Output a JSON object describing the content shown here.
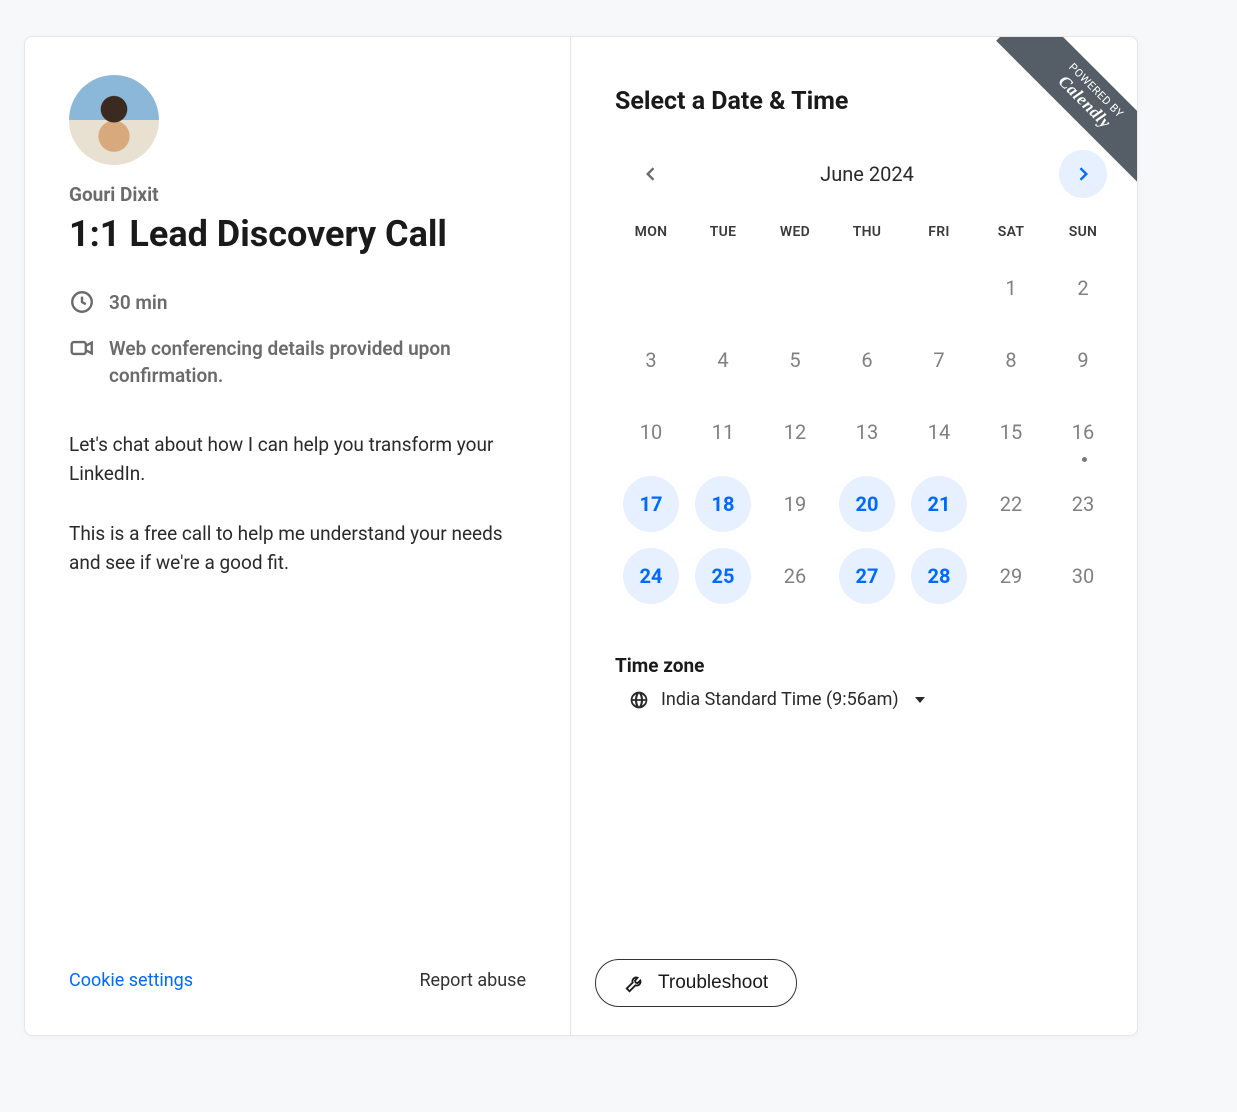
{
  "host": {
    "name": "Gouri Dixit"
  },
  "event": {
    "title": "1:1 Lead Discovery Call",
    "duration": "30 min",
    "location_note": "Web conferencing details provided upon confirmation.",
    "description_p1": "Let's chat about how I can help you transform your LinkedIn.",
    "description_p2": "This is a free call to help me understand your needs and see if we're a good fit."
  },
  "calendar": {
    "heading": "Select a Date & Time",
    "month_label": "June 2024",
    "day_headers": [
      "MON",
      "TUE",
      "WED",
      "THU",
      "FRI",
      "SAT",
      "SUN"
    ],
    "weeks": [
      [
        {
          "n": ""
        },
        {
          "n": ""
        },
        {
          "n": ""
        },
        {
          "n": ""
        },
        {
          "n": ""
        },
        {
          "n": "1",
          "state": "disabled"
        },
        {
          "n": "2",
          "state": "disabled"
        }
      ],
      [
        {
          "n": "3",
          "state": "disabled"
        },
        {
          "n": "4",
          "state": "disabled"
        },
        {
          "n": "5",
          "state": "disabled"
        },
        {
          "n": "6",
          "state": "disabled"
        },
        {
          "n": "7",
          "state": "disabled"
        },
        {
          "n": "8",
          "state": "disabled"
        },
        {
          "n": "9",
          "state": "disabled"
        }
      ],
      [
        {
          "n": "10",
          "state": "disabled"
        },
        {
          "n": "11",
          "state": "disabled"
        },
        {
          "n": "12",
          "state": "disabled"
        },
        {
          "n": "13",
          "state": "disabled"
        },
        {
          "n": "14",
          "state": "disabled"
        },
        {
          "n": "15",
          "state": "disabled"
        },
        {
          "n": "16",
          "state": "disabled",
          "today": true
        }
      ],
      [
        {
          "n": "17",
          "state": "available"
        },
        {
          "n": "18",
          "state": "available"
        },
        {
          "n": "19",
          "state": "disabled"
        },
        {
          "n": "20",
          "state": "available"
        },
        {
          "n": "21",
          "state": "available"
        },
        {
          "n": "22",
          "state": "disabled"
        },
        {
          "n": "23",
          "state": "disabled"
        }
      ],
      [
        {
          "n": "24",
          "state": "available"
        },
        {
          "n": "25",
          "state": "available"
        },
        {
          "n": "26",
          "state": "disabled"
        },
        {
          "n": "27",
          "state": "available"
        },
        {
          "n": "28",
          "state": "available"
        },
        {
          "n": "29",
          "state": "disabled"
        },
        {
          "n": "30",
          "state": "disabled"
        }
      ]
    ]
  },
  "timezone": {
    "heading": "Time zone",
    "selected": "India Standard Time (9:56am)"
  },
  "footer": {
    "cookie": "Cookie settings",
    "report": "Report abuse",
    "troubleshoot": "Troubleshoot"
  },
  "ribbon": {
    "prefix": "POWERED BY",
    "brand": "Calendly"
  }
}
